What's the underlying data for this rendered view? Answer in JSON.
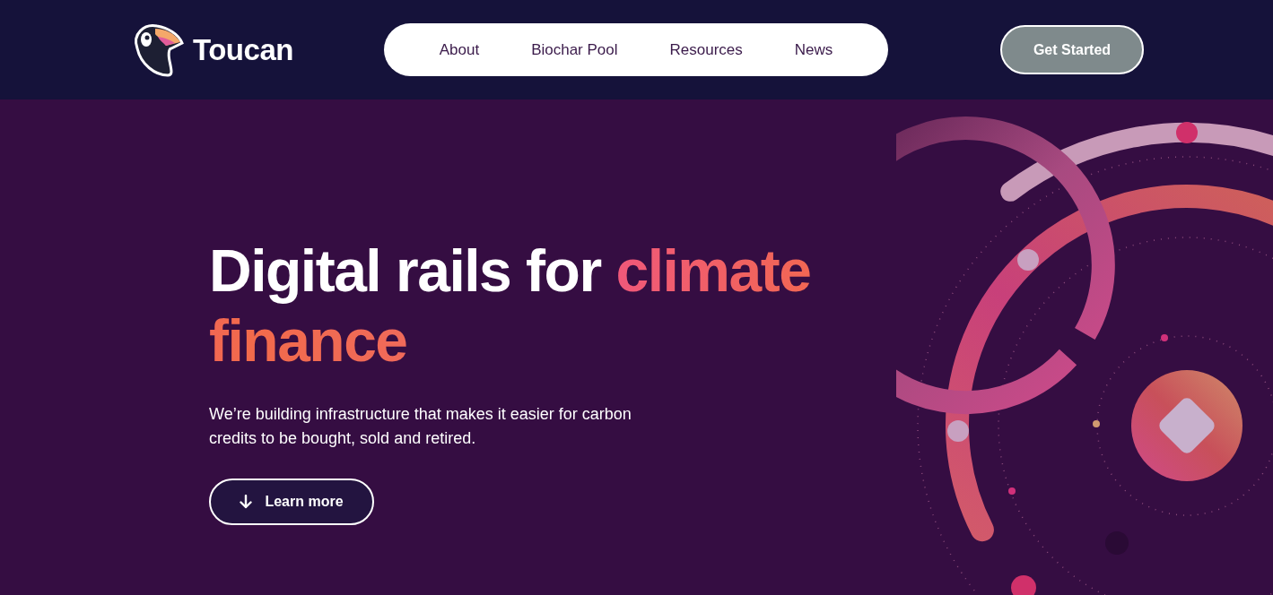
{
  "brand": {
    "name": "Toucan"
  },
  "nav": {
    "links": [
      "About",
      "Biochar Pool",
      "Resources",
      "News"
    ]
  },
  "cta": {
    "label": "Get Started"
  },
  "hero": {
    "headline": "Digital rails for ",
    "highlight": "climate finance",
    "text": "We’re building infrastructure that makes it easier for carbon credits to be bought, sold and retired.",
    "button": "Learn more"
  }
}
